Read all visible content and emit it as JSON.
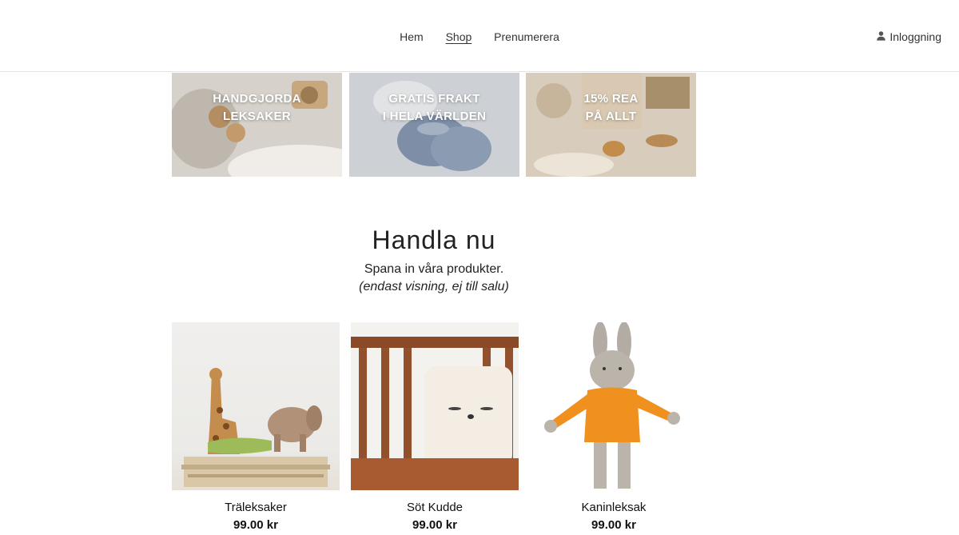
{
  "nav": {
    "items": [
      {
        "label": "Hem",
        "active": false
      },
      {
        "label": "Shop",
        "active": true
      },
      {
        "label": "Prenumerera",
        "active": false
      }
    ],
    "login_label": "Inloggning",
    "login_icon": "user-icon"
  },
  "banners": [
    {
      "line1": "HANDGJORDA",
      "line2": "LEKSAKER"
    },
    {
      "line1": "GRATIS FRAKT",
      "line2": "I HELA VÄRLDEN"
    },
    {
      "line1": "15% REA",
      "line2": "PÅ ALLT"
    }
  ],
  "section": {
    "title": "Handla nu",
    "subtitle": "Spana in våra produkter.",
    "note": "(endast visning, ej till salu)"
  },
  "products": [
    {
      "name": "Träleksaker",
      "price": "99.00 kr"
    },
    {
      "name": "Söt Kudde",
      "price": "99.00 kr"
    },
    {
      "name": "Kaninleksak",
      "price": "99.00 kr"
    }
  ]
}
